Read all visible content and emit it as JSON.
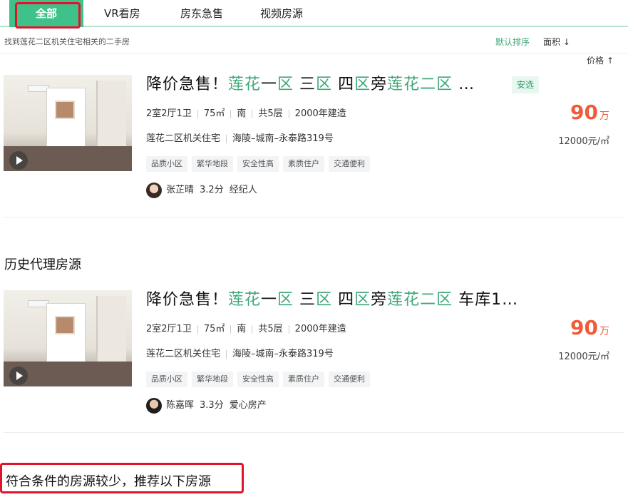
{
  "tabs": [
    {
      "label": "全部",
      "active": true
    },
    {
      "label": "VR看房"
    },
    {
      "label": "房东急售"
    },
    {
      "label": "视频房源"
    }
  ],
  "subbar": {
    "found_text": "找到莲花二区机关住宅相关的二手房",
    "sort_default": "默认排序",
    "sort_area": "面积 ↓",
    "sort_price": "价格 ↑"
  },
  "listings": [
    {
      "title_parts": [
        "降价急售！",
        "莲花",
        "一",
        "区",
        " 三",
        "区",
        " 四",
        "区",
        "旁",
        "莲花二区",
        " …"
      ],
      "badge": "安选",
      "meta": [
        "2室2厅1卫",
        "75㎡",
        "南",
        "共5层",
        "2000年建造"
      ],
      "community": "莲花二区机关住宅",
      "address": "海陵–城南–永泰路319号",
      "tags": [
        "品质小区",
        "繁华地段",
        "安全性高",
        "素质住户",
        "交通便利"
      ],
      "agent_name": "张芷晴",
      "agent_score": "3.2分",
      "agent_role": "经纪人",
      "price": "90",
      "price_unit": "万",
      "unit_price": "12000元/㎡"
    },
    {
      "title_parts": [
        "降价急售！",
        "莲花",
        "一",
        "区",
        " 三",
        "区",
        " 四",
        "区",
        "旁",
        "莲花二区",
        " 车库1…"
      ],
      "meta": [
        "2室2厅1卫",
        "75㎡",
        "南",
        "共5层",
        "2000年建造"
      ],
      "community": "莲花二区机关住宅",
      "address": "海陵–城南–永泰路319号",
      "tags": [
        "品质小区",
        "繁华地段",
        "安全性高",
        "素质住户",
        "交通便利"
      ],
      "agent_name": "陈嘉晖",
      "agent_score": "3.3分",
      "agent_role": "爱心房产",
      "price": "90",
      "price_unit": "万",
      "unit_price": "12000元/㎡"
    }
  ],
  "section_history": "历史代理房源",
  "recommend_text": "符合条件的房源较少，推荐以下房源",
  "colors": {
    "accent": "#3fc28a",
    "highlight": "#3fa878",
    "price": "#f25b3a",
    "annotation": "#e3122a"
  }
}
